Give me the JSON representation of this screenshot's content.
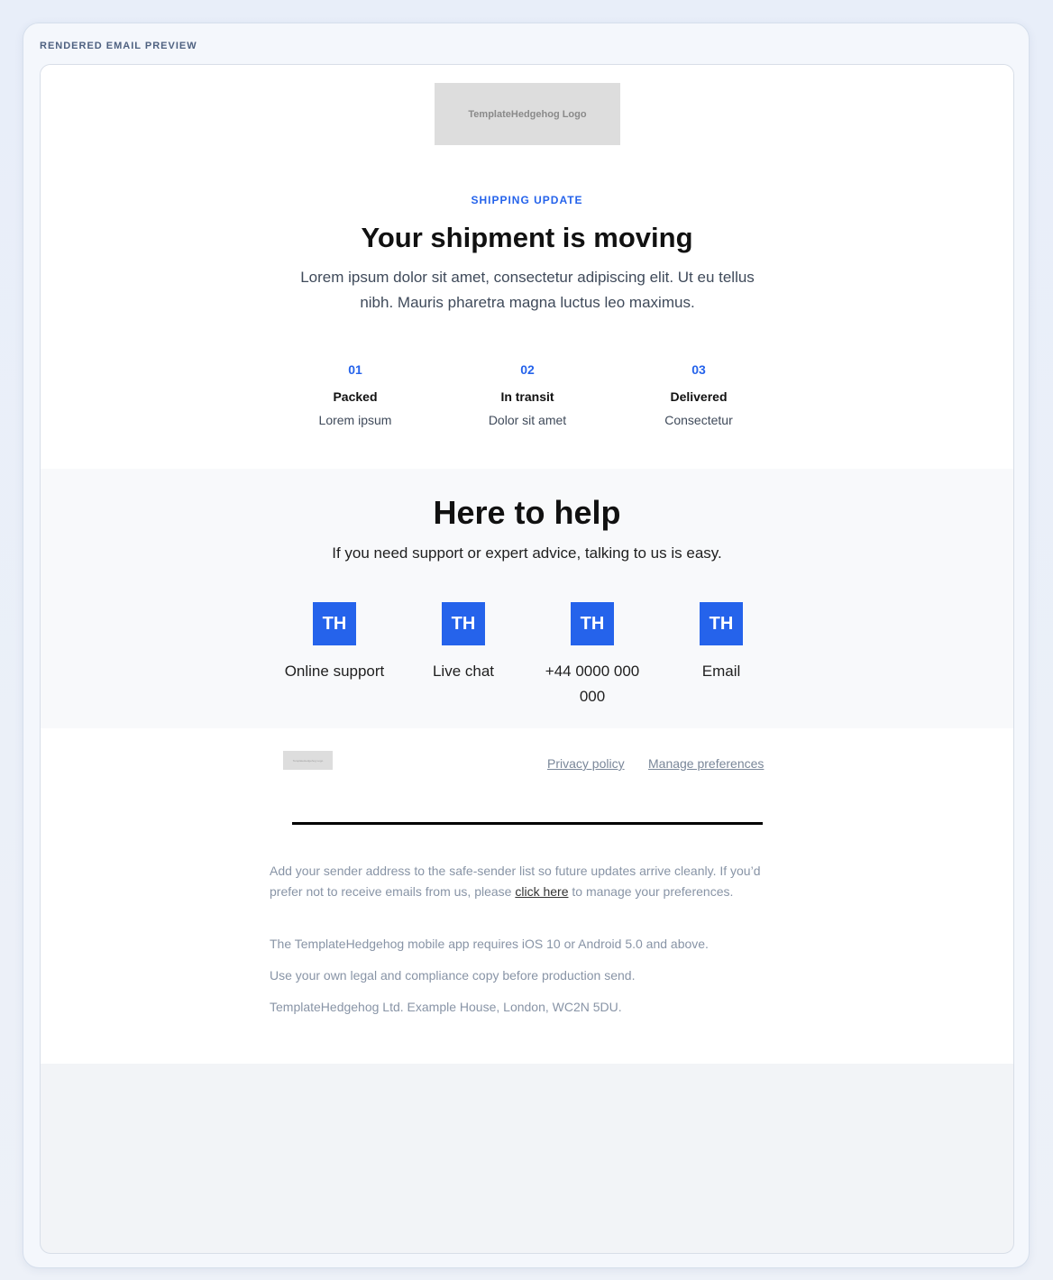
{
  "preview": {
    "label": "RENDERED EMAIL PREVIEW"
  },
  "header": {
    "logo_text": "TemplateHedgehog Logo"
  },
  "hero": {
    "eyebrow": "SHIPPING UPDATE",
    "title": "Your shipment is moving",
    "body": "Lorem ipsum dolor sit amet, consectetur adipiscing elit. Ut eu tellus nibh. Mauris pharetra magna luctus leo maximus."
  },
  "steps": [
    {
      "number": "01",
      "title": "Packed",
      "description": "Lorem ipsum"
    },
    {
      "number": "02",
      "title": "In transit",
      "description": "Dolor sit amet"
    },
    {
      "number": "03",
      "title": "Delivered",
      "description": "Consectetur"
    }
  ],
  "help": {
    "title": "Here to help",
    "subtitle": "If you need support or expert advice, talking to us is easy.",
    "contacts": [
      {
        "icon_text": "TH",
        "label": "Online support"
      },
      {
        "icon_text": "TH",
        "label": "Live chat"
      },
      {
        "icon_text": "TH",
        "label": "+44 0000 000 000"
      },
      {
        "icon_text": "TH",
        "label": "Email"
      }
    ]
  },
  "footer": {
    "logo_text": "TemplateHedgehog Logo",
    "links": {
      "privacy": "Privacy policy",
      "preferences": "Manage preferences"
    },
    "paragraph_1_before": "Add your sender address to the safe-sender list so future updates arrive cleanly. If you’d prefer not to receive emails from us, please ",
    "paragraph_1_link": "click here",
    "paragraph_1_after": " to manage your preferences.",
    "paragraph_2": "The TemplateHedgehog mobile app requires iOS 10 or Android 5.0 and above.",
    "paragraph_3": "Use your own legal and compliance copy before production send.",
    "paragraph_4": "TemplateHedgehog Ltd. Example House, London, WC2N 5DU."
  },
  "colors": {
    "accent": "#2563eb",
    "heading": "#111111",
    "body_text": "#3f4a5a",
    "footer_text": "#8894a6",
    "placeholder": "#dddddd"
  }
}
